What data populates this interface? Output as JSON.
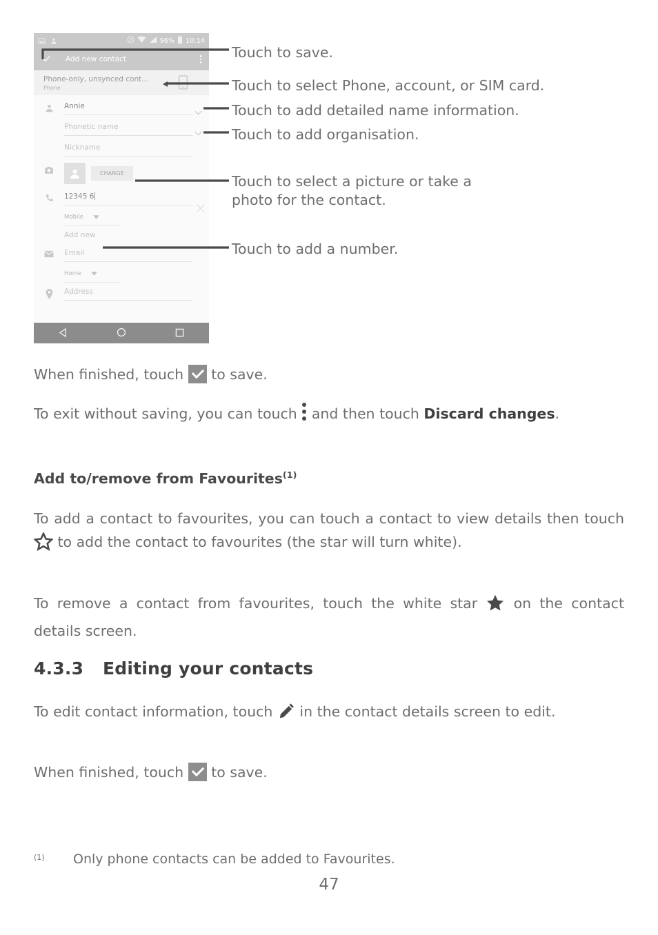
{
  "figure": {
    "phone_screenshot": {
      "status_bar": {
        "left_icons": [
          "image-icon",
          "contact-icon"
        ],
        "nfc_icon": "nfc-icon",
        "wifi_icon": "wifi-icon",
        "signal_icon": "signal-icon",
        "battery_percent": "96%",
        "battery_icon": "battery-icon",
        "clock": "10:14"
      },
      "app_bar": {
        "save_icon": "checkmark-icon",
        "title": "Add new contact",
        "overflow_icon": "more-vertical-icon"
      },
      "account_row": {
        "name": "Phone-only, unsynced cont...",
        "subtitle": "Phone",
        "device_icon": "phone-device-icon"
      },
      "fields": [
        {
          "gutter_icon": "person-icon",
          "value": "Annie",
          "is_placeholder": false,
          "chevron": true
        },
        {
          "gutter_icon": "",
          "value": "Phonetic name",
          "is_placeholder": true,
          "chevron": true
        },
        {
          "gutter_icon": "",
          "value": "Nickname",
          "is_placeholder": true,
          "chevron": false
        },
        {
          "gutter_icon": "camera-icon",
          "value": "",
          "is_placeholder": true,
          "chevron": false
        },
        {
          "gutter_icon": "phone-icon",
          "value": "12345 6",
          "is_placeholder": false,
          "chevron": false
        },
        {
          "gutter_icon": "",
          "value": "Mobile",
          "is_placeholder": true,
          "chevron": false
        },
        {
          "gutter_icon": "",
          "value": "Add new",
          "is_placeholder": true,
          "chevron": false
        },
        {
          "gutter_icon": "envelope-icon",
          "value": "Email",
          "is_placeholder": true,
          "chevron": false
        },
        {
          "gutter_icon": "",
          "value": "Home",
          "is_placeholder": true,
          "chevron": false
        },
        {
          "gutter_icon": "location-pin-icon",
          "value": "Address",
          "is_placeholder": true,
          "chevron": false
        }
      ],
      "photo_block": {
        "avatar_icon": "person-avatar-icon",
        "change_button": "CHANGE"
      },
      "nav_bar": {
        "back_icon": "triangle-back-icon",
        "home_icon": "circle-home-icon",
        "recents_icon": "square-recents-icon"
      },
      "colors": {
        "app_bar": "#c9c9c9",
        "nav_bar": "#8c8c8c",
        "form_bg": "#fafafa",
        "account_bg": "#f1f1f1"
      }
    },
    "annotations": [
      {
        "id": "save",
        "text": "Touch to save."
      },
      {
        "id": "account",
        "text": "Touch to select Phone, account, or SIM card."
      },
      {
        "id": "name-detail",
        "text": "Touch to add detailed name information."
      },
      {
        "id": "organisation",
        "text": "Touch to add organisation."
      },
      {
        "id": "picture",
        "text": "Touch to select a picture or take a photo for the contact."
      },
      {
        "id": "add-number",
        "text": "Touch to add a number."
      }
    ]
  },
  "body": {
    "p1": {
      "before": "When finished, touch ",
      "after": " to save."
    },
    "p2": {
      "before": "To exit without saving, you can touch ",
      "mid": " and then touch ",
      "bold": "Discard changes",
      "after": "."
    },
    "subheading": {
      "text": "Add to/remove from Favourites",
      "footnote_mark": "(1)"
    },
    "p3": {
      "before": "To add a contact to favourites, you can touch a contact to view details then touch ",
      "after": " to add the contact to favourites (the star will turn white)."
    },
    "p4": {
      "before": "To remove a contact from favourites, touch the white star ",
      "after": " on the contact details screen."
    },
    "section": {
      "number": "4.3.3",
      "title": "Editing your contacts"
    },
    "p5": {
      "before": "To edit contact information, touch ",
      "after": " in the contact details screen to edit."
    },
    "p6": {
      "before": "When finished, touch ",
      "after": " to save."
    },
    "footnote": {
      "mark": "(1)",
      "text": "Only phone contacts can be added to Favourites."
    },
    "page_number": "47",
    "icons": {
      "checkmark": "checkmark-button-icon",
      "overflow": "more-vertical-icon",
      "star_outline": "star-outline-icon",
      "star_filled": "star-filled-icon",
      "pencil": "pencil-edit-icon"
    },
    "colors": {
      "text": "#6e6e6e",
      "bold_text": "#3f3f3f",
      "icon": "#4a4a4a",
      "check_box": "#8d8d8d"
    }
  }
}
